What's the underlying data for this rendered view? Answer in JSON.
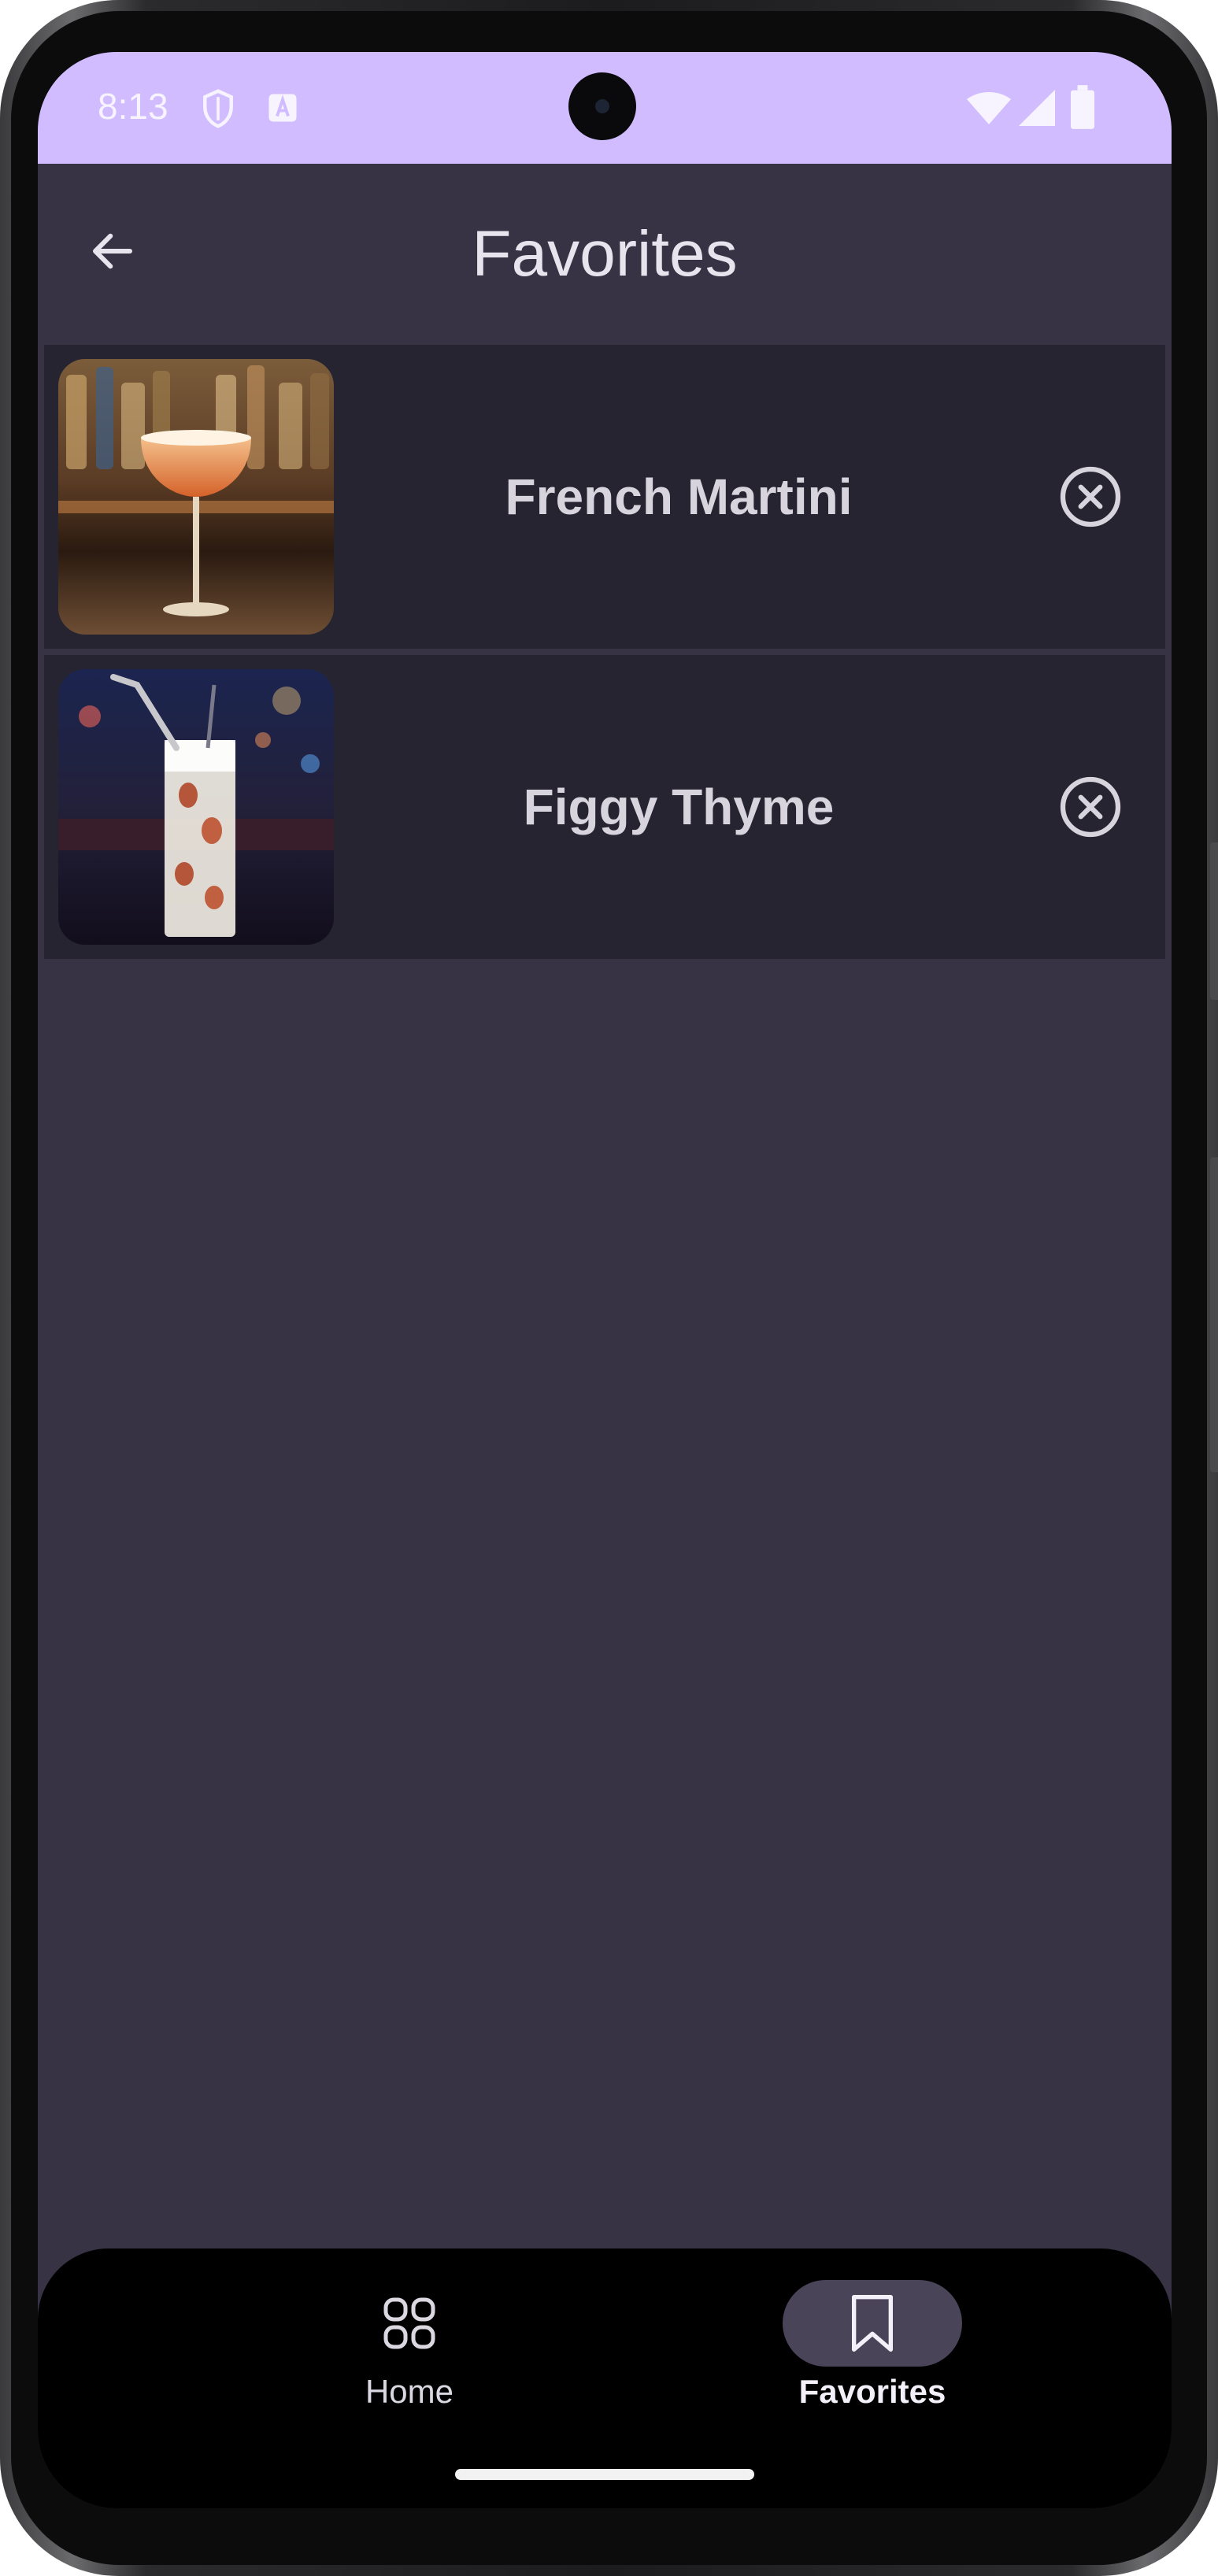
{
  "status_bar": {
    "time": "8:13",
    "background": "#d0bcff"
  },
  "app_bar": {
    "title": "Favorites",
    "back_icon": "arrow-back-icon"
  },
  "favorites": [
    {
      "name": "French Martini",
      "image": "french-martini-photo",
      "remove_icon": "close-circle-icon"
    },
    {
      "name": "Figgy Thyme",
      "image": "figgy-thyme-photo",
      "remove_icon": "close-circle-icon"
    }
  ],
  "bottom_nav": {
    "items": [
      {
        "label": "Home",
        "icon": "grid-icon",
        "selected": false
      },
      {
        "label": "Favorites",
        "icon": "bookmark-icon",
        "selected": true
      }
    ]
  },
  "colors": {
    "background": "#373244",
    "list_item": "#262431",
    "nav_selected_pill": "#4a4459"
  }
}
